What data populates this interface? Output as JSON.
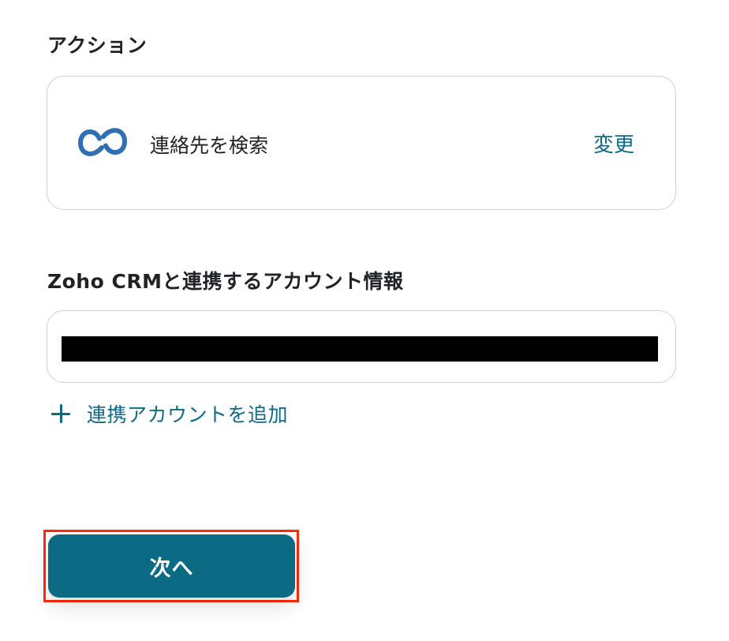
{
  "action_section": {
    "label": "アクション",
    "app_icon": "zoho-crm-icon",
    "action_name": "連絡先を検索",
    "change_label": "変更"
  },
  "account_section": {
    "label": "Zoho CRMと連携するアカウント情報",
    "add_account_icon": "plus-icon",
    "add_account_label": "連携アカウントを追加"
  },
  "footer": {
    "next_label": "次へ"
  },
  "colors": {
    "accent": "#0f6a85",
    "button_bg": "#0b6b85",
    "highlight_border": "#ff2a0a",
    "icon_blue": "#2f6fb3"
  }
}
